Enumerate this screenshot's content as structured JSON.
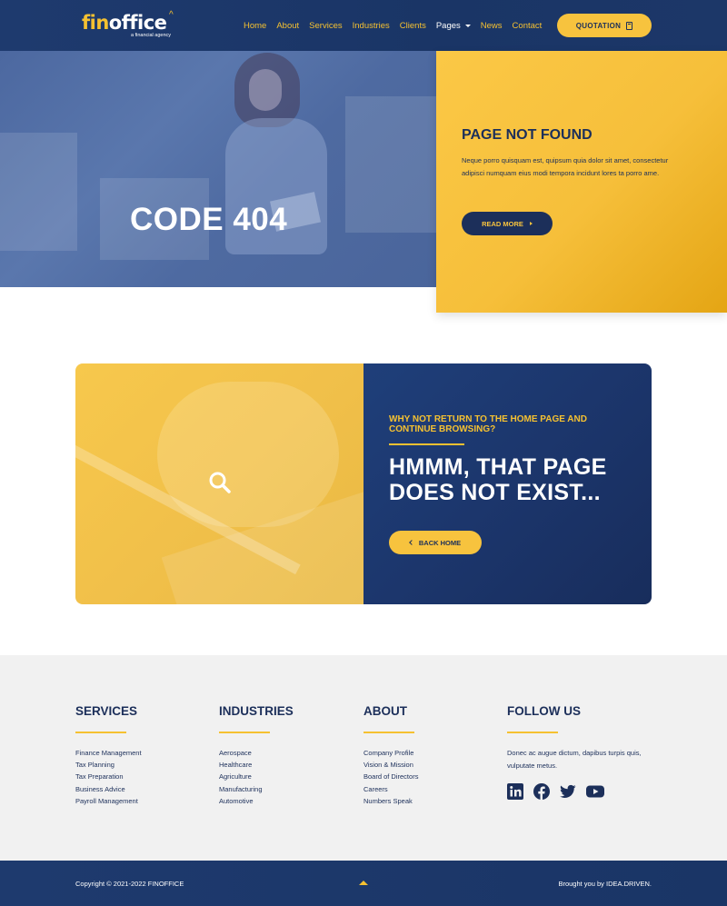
{
  "brand": {
    "logo_fin": "fin",
    "logo_office": "offic",
    "logo_e": "e",
    "tagline": "a financial agency",
    "accent_color": "#f5c131",
    "navy_color": "#1c2f5a"
  },
  "nav": {
    "items": [
      {
        "label": "Home"
      },
      {
        "label": "About"
      },
      {
        "label": "Services"
      },
      {
        "label": "Industries"
      },
      {
        "label": "Clients"
      },
      {
        "label": "Pages"
      },
      {
        "label": "News"
      },
      {
        "label": "Contact"
      }
    ],
    "quote_button": "QUOTATION",
    "quote_icon": "calculator-icon"
  },
  "hero": {
    "title": "CODE 404",
    "card_title": "PAGE NOT FOUND",
    "card_text": "Neque porro quisquam est, quipsum quia dolor sit amet, consectetur adipisci numquam eius modi tempora incidunt lores ta porro ame.",
    "read_more": "READ MORE"
  },
  "error_panel": {
    "icon": "search-icon",
    "eyebrow": "WHY NOT RETURN TO THE HOME PAGE AND CONTINUE BROWSING?",
    "headline": "HMMM, THAT PAGE DOES NOT EXIST...",
    "back_button": "BACK HOME"
  },
  "footer": {
    "services": {
      "title": "SERVICES",
      "links": [
        "Finance Management",
        "Tax Planning",
        "Tax Preparation",
        "Business Advice",
        "Payroll Management"
      ]
    },
    "industries": {
      "title": "INDUSTRIES",
      "links": [
        "Aerospace",
        "Healthcare",
        "Agriculture",
        "Manufacturing",
        "Automotive"
      ]
    },
    "about": {
      "title": "ABOUT",
      "links": [
        "Company Profile",
        "Vision & Mission",
        "Board of Directors",
        "Careers",
        "Numbers Speak"
      ]
    },
    "follow": {
      "title": "FOLLOW US",
      "text": "Donec ac augue dictum, dapibus turpis quis, vulputate metus.",
      "icons": [
        "linkedin-icon",
        "facebook-icon",
        "twitter-icon",
        "youtube-icon"
      ]
    },
    "copyright": "Copyright © 2021-2022 FINOFFICE",
    "credit": "Brought you by IDEA.DRIVEN."
  }
}
